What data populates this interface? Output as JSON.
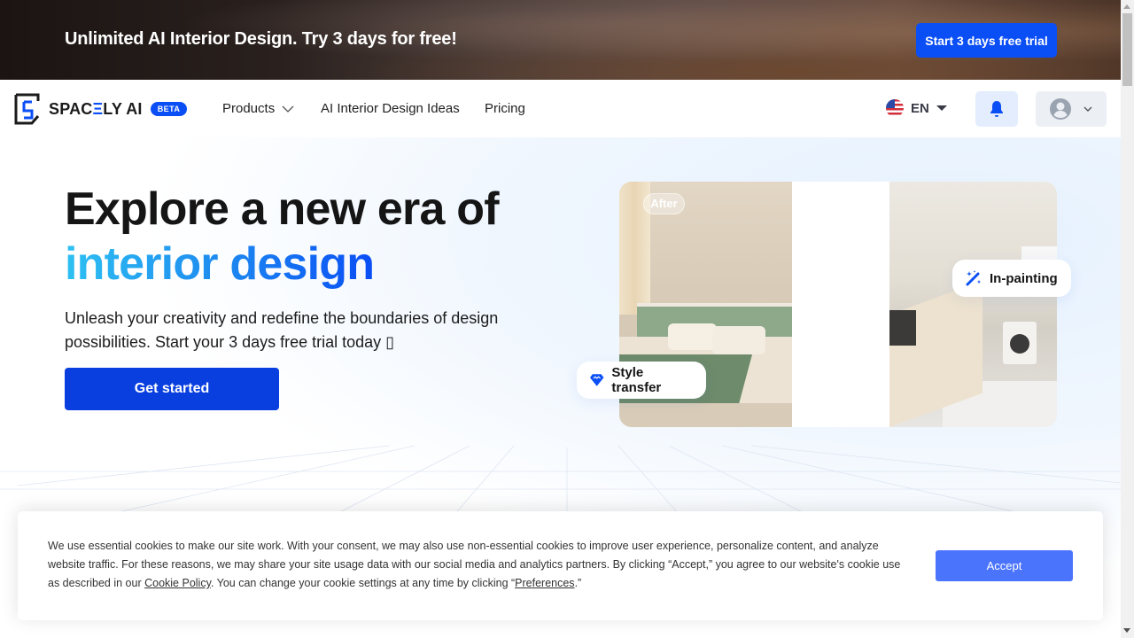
{
  "promo": {
    "text": "Unlimited AI Interior Design. Try 3 days for free!",
    "button_label": "Start 3 days free trial"
  },
  "nav": {
    "logo_prefix": "SPAC",
    "logo_e": "Ξ",
    "logo_suffix": "LY AI",
    "beta_label": "BETA",
    "links": [
      {
        "label": "Products",
        "has_dropdown": true
      },
      {
        "label": "AI Interior Design Ideas"
      },
      {
        "label": "Pricing"
      }
    ],
    "language": {
      "code": "EN",
      "flag": "us-flag-icon"
    },
    "notification_icon": "bell-icon",
    "user_icon": "user-avatar-icon"
  },
  "hero": {
    "title_line1": "Explore a new era of",
    "title_line2": "interior design",
    "subtitle": "Unleash your creativity and redefine the boundaries of design possibilities. Start your 3 days free trial today ▯",
    "cta_label": "Get started",
    "showcase": {
      "after_label": "After",
      "chips": [
        {
          "label": "Style transfer",
          "icon": "diamond-icon"
        },
        {
          "label": "In-painting",
          "icon": "magic-wand-icon"
        }
      ]
    }
  },
  "cookie_banner": {
    "text_part1": "We use essential cookies to make our site work. With your consent, we may also use non-essential cookies to improve user experience, personalize content, and analyze website traffic. For these reasons, we may share your site usage data with our social media and analytics partners. By clicking “Accept,” you agree to our website's cookie use as described in our ",
    "cookie_policy_link": "Cookie Policy",
    "text_part2": ". You can change your cookie settings at any time by clicking “",
    "preferences_link": "Preferences",
    "text_part3": ".”",
    "accept_label": "Accept"
  },
  "colors": {
    "brand_blue": "#0a4ef5",
    "cta_blue": "#0a3fdf",
    "accept_blue": "#4a74fc",
    "gradient_start": "#2ec0f2",
    "gradient_end": "#0a4ef5"
  }
}
